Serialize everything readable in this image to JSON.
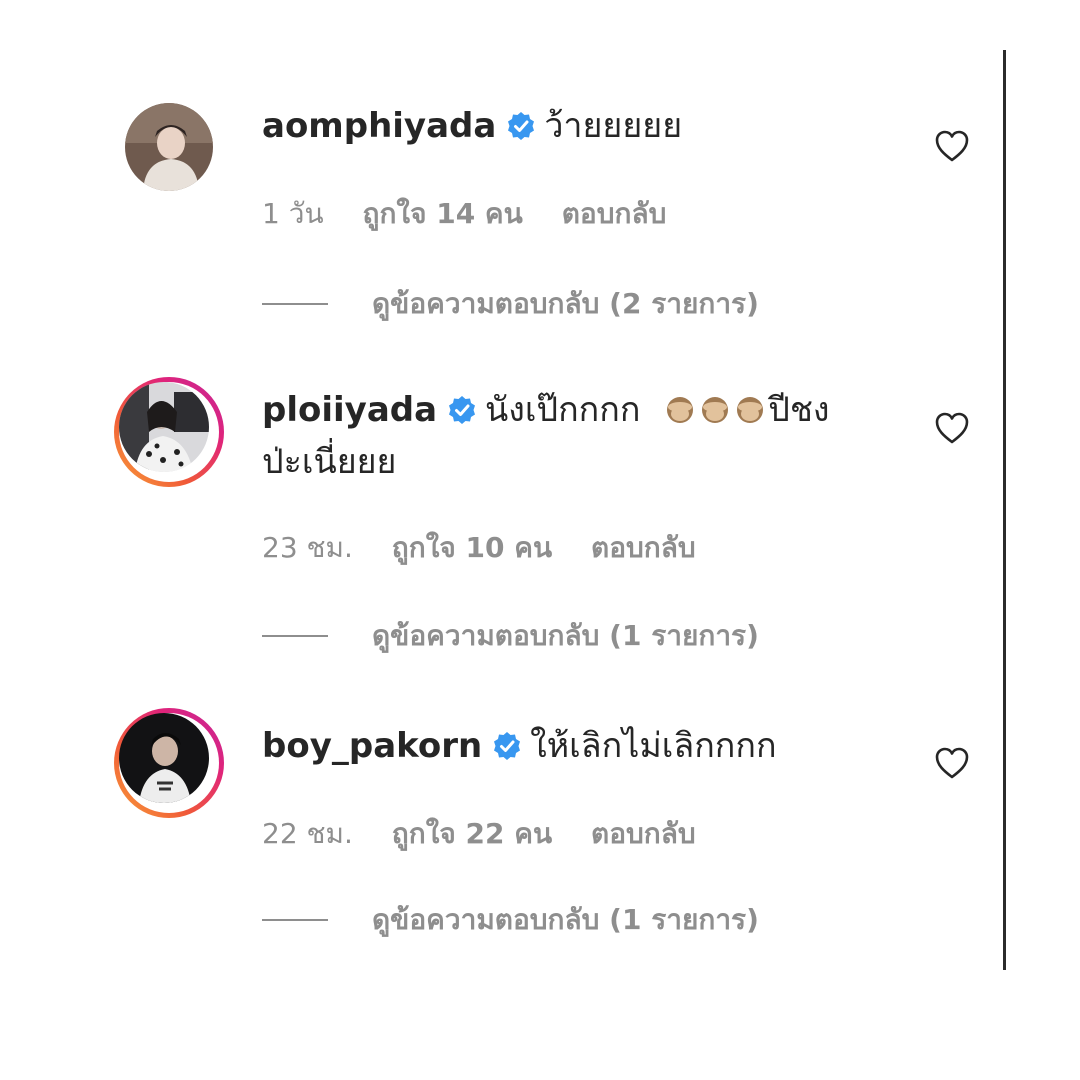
{
  "comments": [
    {
      "username": "aomphiyada",
      "text": "ว้ายยยยย",
      "text_line2": "",
      "time": "1 วัน",
      "likes": "ถูกใจ 14 คน",
      "reply": "ตอบกลับ",
      "view_replies": "ดูข้อความตอบกลับ (2 รายการ)"
    },
    {
      "username": "ploiiyada",
      "text": "นังเป๊กกกก",
      "text_after_emoji": "ปีชง",
      "text_line2": "ป่ะเนี่ยยย",
      "emoji": "see-no-evil-monkey-icon x3",
      "time": "23 ชม.",
      "likes": "ถูกใจ 10 คน",
      "reply": "ตอบกลับ",
      "view_replies": "ดูข้อความตอบกลับ (1 รายการ)"
    },
    {
      "username": "boy_pakorn",
      "text": "ให้เลิกไม่เลิกกกก",
      "text_line2": "",
      "time": "22 ชม.",
      "likes": "ถูกใจ 22 คน",
      "reply": "ตอบกลับ",
      "view_replies": "ดูข้อความตอบกลับ (1 รายการ)"
    }
  ],
  "colors": {
    "verified": "#3897f0",
    "meta_text": "#8e8e8e",
    "primary_text": "#262626"
  }
}
